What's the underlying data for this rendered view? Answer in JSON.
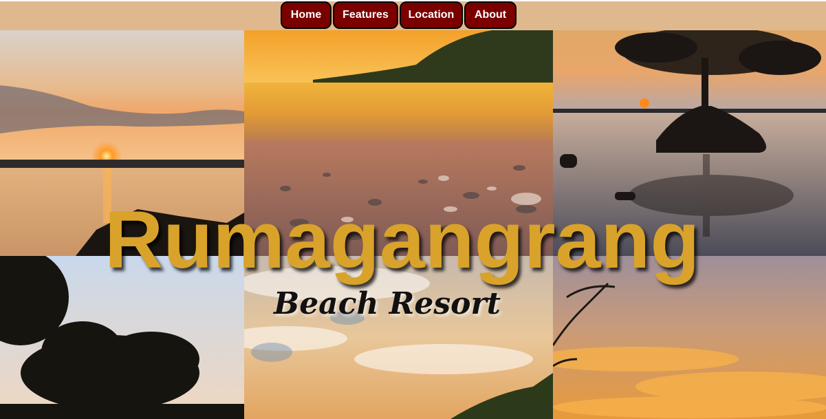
{
  "nav": {
    "items": [
      {
        "label": "Home"
      },
      {
        "label": "Features"
      },
      {
        "label": "Location"
      },
      {
        "label": "About"
      }
    ]
  },
  "hero": {
    "title": "Rumagangrang",
    "subtitle": "Beach Resort"
  },
  "gallery": {
    "photos": [
      "sunset-over-sea-with-clouds",
      "golden-pebble-beach-sunset",
      "mangrove-tree-sunset-reflection",
      "tree-silhouette-blue-sky",
      "cloudy-golden-sky-over-hill",
      "orange-cloud-sunset-sky"
    ]
  },
  "colors": {
    "navbar": "#dfb98d",
    "nav_button": "#7a0000",
    "title": "#d9a22a"
  }
}
